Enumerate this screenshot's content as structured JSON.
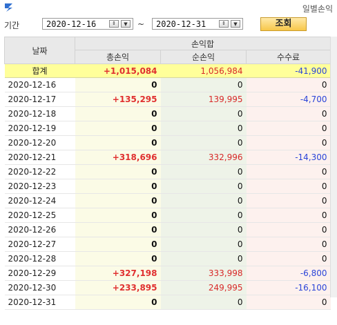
{
  "window": {
    "title": "일별손익"
  },
  "period": {
    "label": "기간",
    "start_date": "2020-12-16",
    "separator": "~",
    "end_date": "2020-12-31",
    "search_label": "조회"
  },
  "table": {
    "col_date": "날짜",
    "group_label": "손익합",
    "col_gross": "총손익",
    "col_net": "순손익",
    "col_fee": "수수료",
    "total": {
      "label": "합계",
      "gross": "+1,015,084",
      "net": "1,056,984",
      "fee": "-41,900"
    },
    "rows": [
      {
        "date": "2020-12-16",
        "gross": "0",
        "net": "0",
        "fee": "0"
      },
      {
        "date": "2020-12-17",
        "gross": "+135,295",
        "net": "139,995",
        "fee": "-4,700"
      },
      {
        "date": "2020-12-18",
        "gross": "0",
        "net": "0",
        "fee": "0"
      },
      {
        "date": "2020-12-19",
        "gross": "0",
        "net": "0",
        "fee": "0"
      },
      {
        "date": "2020-12-20",
        "gross": "0",
        "net": "0",
        "fee": "0"
      },
      {
        "date": "2020-12-21",
        "gross": "+318,696",
        "net": "332,996",
        "fee": "-14,300"
      },
      {
        "date": "2020-12-22",
        "gross": "0",
        "net": "0",
        "fee": "0"
      },
      {
        "date": "2020-12-23",
        "gross": "0",
        "net": "0",
        "fee": "0"
      },
      {
        "date": "2020-12-24",
        "gross": "0",
        "net": "0",
        "fee": "0"
      },
      {
        "date": "2020-12-25",
        "gross": "0",
        "net": "0",
        "fee": "0"
      },
      {
        "date": "2020-12-26",
        "gross": "0",
        "net": "0",
        "fee": "0"
      },
      {
        "date": "2020-12-27",
        "gross": "0",
        "net": "0",
        "fee": "0"
      },
      {
        "date": "2020-12-28",
        "gross": "0",
        "net": "0",
        "fee": "0"
      },
      {
        "date": "2020-12-29",
        "gross": "+327,198",
        "net": "333,998",
        "fee": "-6,800"
      },
      {
        "date": "2020-12-30",
        "gross": "+233,895",
        "net": "249,995",
        "fee": "-16,100"
      },
      {
        "date": "2020-12-31",
        "gross": "0",
        "net": "0",
        "fee": "0"
      }
    ]
  },
  "icons": {
    "app": "app-logo-icon",
    "spin": "spin-updown-icon",
    "drop": "dropdown-arrow-icon"
  },
  "colors": {
    "gain": "#e03030",
    "fee": "#2a44d8",
    "total_bg": "#ffff9a",
    "button": "#f7c74a"
  }
}
